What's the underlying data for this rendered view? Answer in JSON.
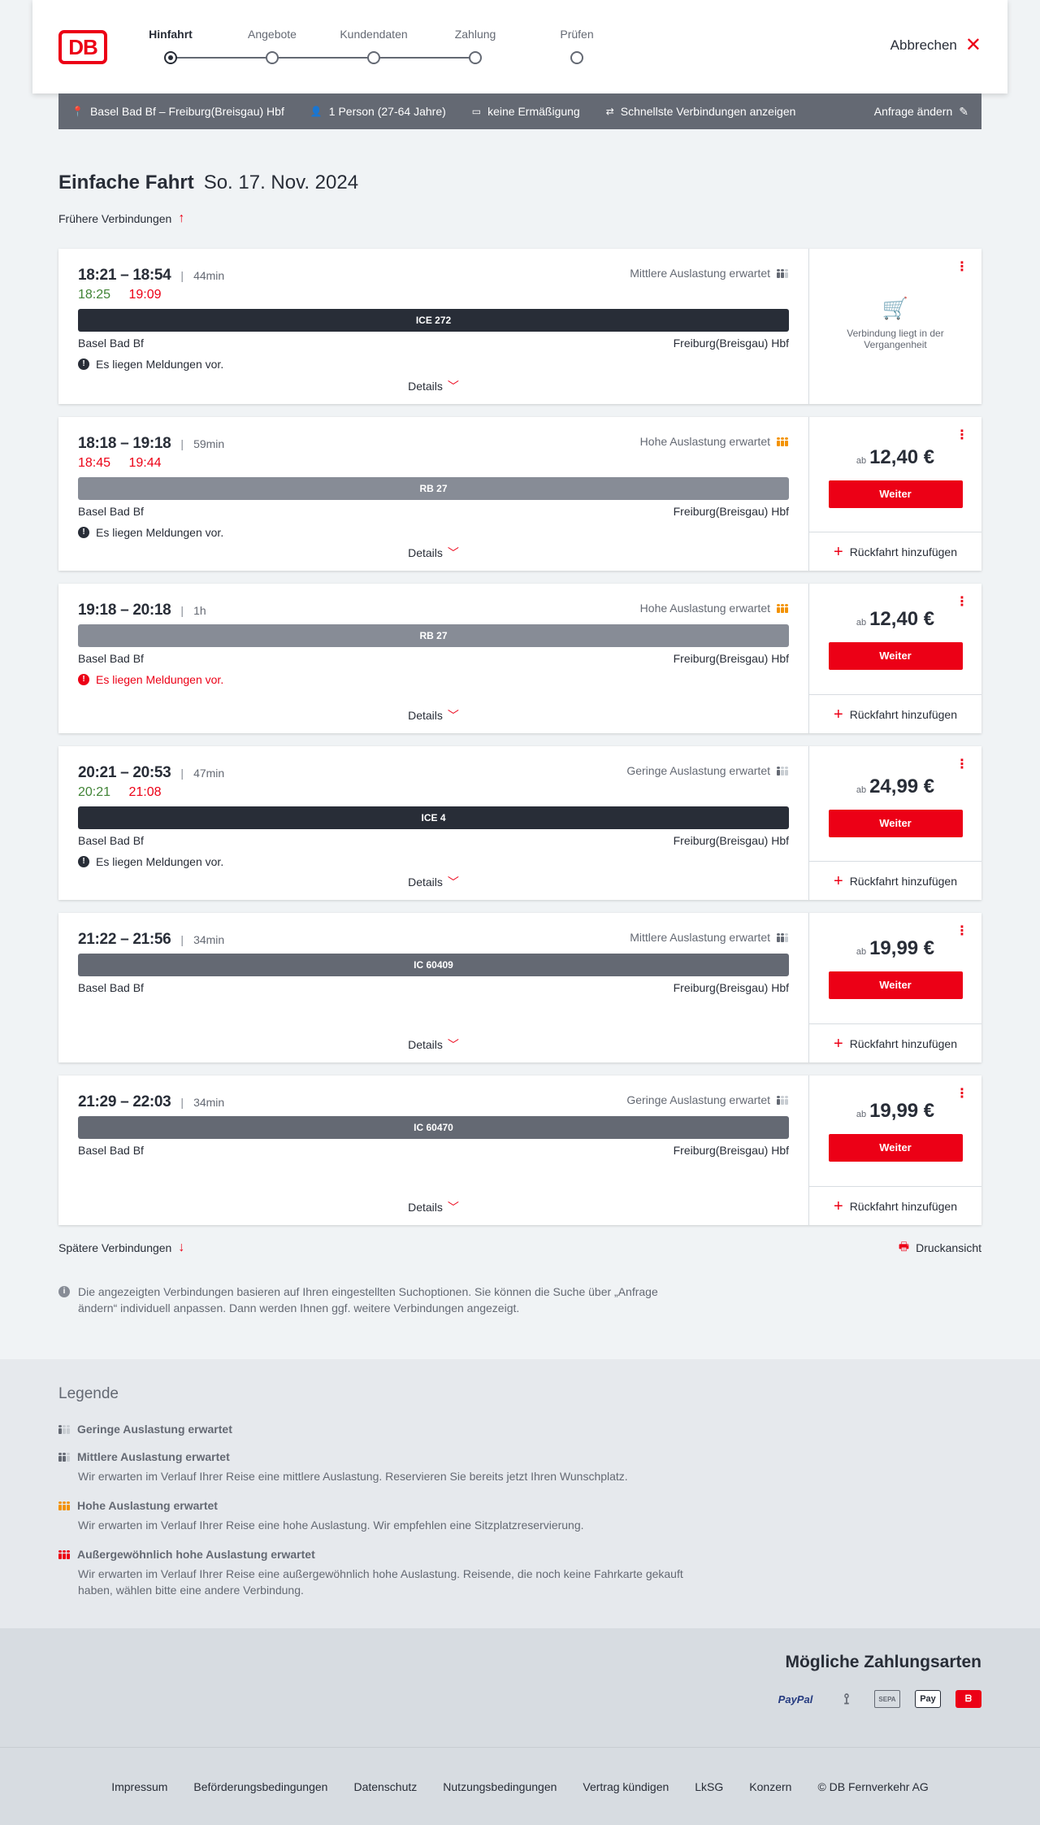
{
  "header": {
    "logo": "DB",
    "steps": [
      "Hinfahrt",
      "Angebote",
      "Kundendaten",
      "Zahlung",
      "Prüfen"
    ],
    "cancel_label": "Abbrechen"
  },
  "search": {
    "route": "Basel Bad Bf – Freiburg(Breisgau) Hbf",
    "passengers": "1 Person (27-64 Jahre)",
    "discount": "keine Ermäßigung",
    "fastest": "Schnellste Verbindungen anzeigen",
    "edit": "Anfrage ändern"
  },
  "title": {
    "main": "Einfache Fahrt",
    "date": "So. 17. Nov. 2024"
  },
  "earlier_label": "Frühere Verbindungen",
  "later_label": "Spätere Verbindungen",
  "print_label": "Druckansicht",
  "details_label": "Details",
  "return_label": "Rückfahrt hinzufügen",
  "weiter_label": "Weiter",
  "ab_label": "ab",
  "connections": [
    {
      "times": "18:21 – 18:54",
      "duration": "44min",
      "load": "Mittlere Auslastung erwartet",
      "rt_dep": "18:25",
      "rt_arr": "19:09",
      "train": "ICE 272",
      "from": "Basel Bad Bf",
      "to": "Freiburg(Breisgau) Hbf",
      "message": "Es liegen Meldungen vor.",
      "past": "Verbindung liegt in der Vergangenheit"
    },
    {
      "times": "18:18 – 19:18",
      "duration": "59min",
      "load": "Hohe Auslastung erwartet",
      "rt_dep": "18:45",
      "rt_arr": "19:44",
      "train": "RB 27",
      "from": "Basel Bad Bf",
      "to": "Freiburg(Breisgau) Hbf",
      "message": "Es liegen Meldungen vor.",
      "price": "12,40 €"
    },
    {
      "times": "19:18 – 20:18",
      "duration": "1h",
      "load": "Hohe Auslastung erwartet",
      "train": "RB 27",
      "from": "Basel Bad Bf",
      "to": "Freiburg(Breisgau) Hbf",
      "message": "Es liegen Meldungen vor.",
      "price": "12,40 €"
    },
    {
      "times": "20:21 – 20:53",
      "duration": "47min",
      "load": "Geringe Auslastung erwartet",
      "rt_dep": "20:21",
      "rt_arr": "21:08",
      "train": "ICE 4",
      "from": "Basel Bad Bf",
      "to": "Freiburg(Breisgau) Hbf",
      "message": "Es liegen Meldungen vor.",
      "price": "24,99 €"
    },
    {
      "times": "21:22 – 21:56",
      "duration": "34min",
      "load": "Mittlere Auslastung erwartet",
      "train": "IC 60409",
      "from": "Basel Bad Bf",
      "to": "Freiburg(Breisgau) Hbf",
      "price": "19,99 €"
    },
    {
      "times": "21:29 – 22:03",
      "duration": "34min",
      "load": "Geringe Auslastung erwartet",
      "train": "IC 60470",
      "from": "Basel Bad Bf",
      "to": "Freiburg(Breisgau) Hbf",
      "price": "19,99 €"
    }
  ],
  "info_text": "Die angezeigten Verbindungen basieren auf Ihren eingestellten Suchoptionen. Sie können die Suche über „Anfrage ändern“ individuell anpassen. Dann werden Ihnen ggf. weitere Verbindungen angezeigt.",
  "legend": {
    "title": "Legende",
    "items": [
      {
        "head": "Geringe Auslastung erwartet",
        "desc": ""
      },
      {
        "head": "Mittlere Auslastung erwartet",
        "desc": "Wir erwarten im Verlauf Ihrer Reise eine mittlere Auslastung. Reservieren Sie bereits jetzt Ihren Wunschplatz."
      },
      {
        "head": "Hohe Auslastung erwartet",
        "desc": "Wir erwarten im Verlauf Ihrer Reise eine hohe Auslastung. Wir empfehlen eine Sitzplatzreservierung."
      },
      {
        "head": "Außergewöhnlich hohe Auslastung erwartet",
        "desc": "Wir erwarten im Verlauf Ihrer Reise eine außergewöhnlich hohe Auslastung. Reisende, die noch keine Fahrkarte gekauft haben, wählen bitte eine andere Verbindung."
      }
    ]
  },
  "payment": {
    "title": "Mögliche Zahlungsarten",
    "paypal": "PayPal",
    "sepa": "SEPA",
    "apple": "Pay"
  },
  "footer": [
    "Impressum",
    "Beförderungsbedingungen",
    "Datenschutz",
    "Nutzungsbedingungen",
    "Vertrag kündigen",
    "LkSG",
    "Konzern",
    "© DB Fernverkehr AG"
  ],
  "colors": {
    "db_red": "#ec0016",
    "dark": "#282d37",
    "delay_green": "#408335",
    "load_high": "#f39200"
  }
}
